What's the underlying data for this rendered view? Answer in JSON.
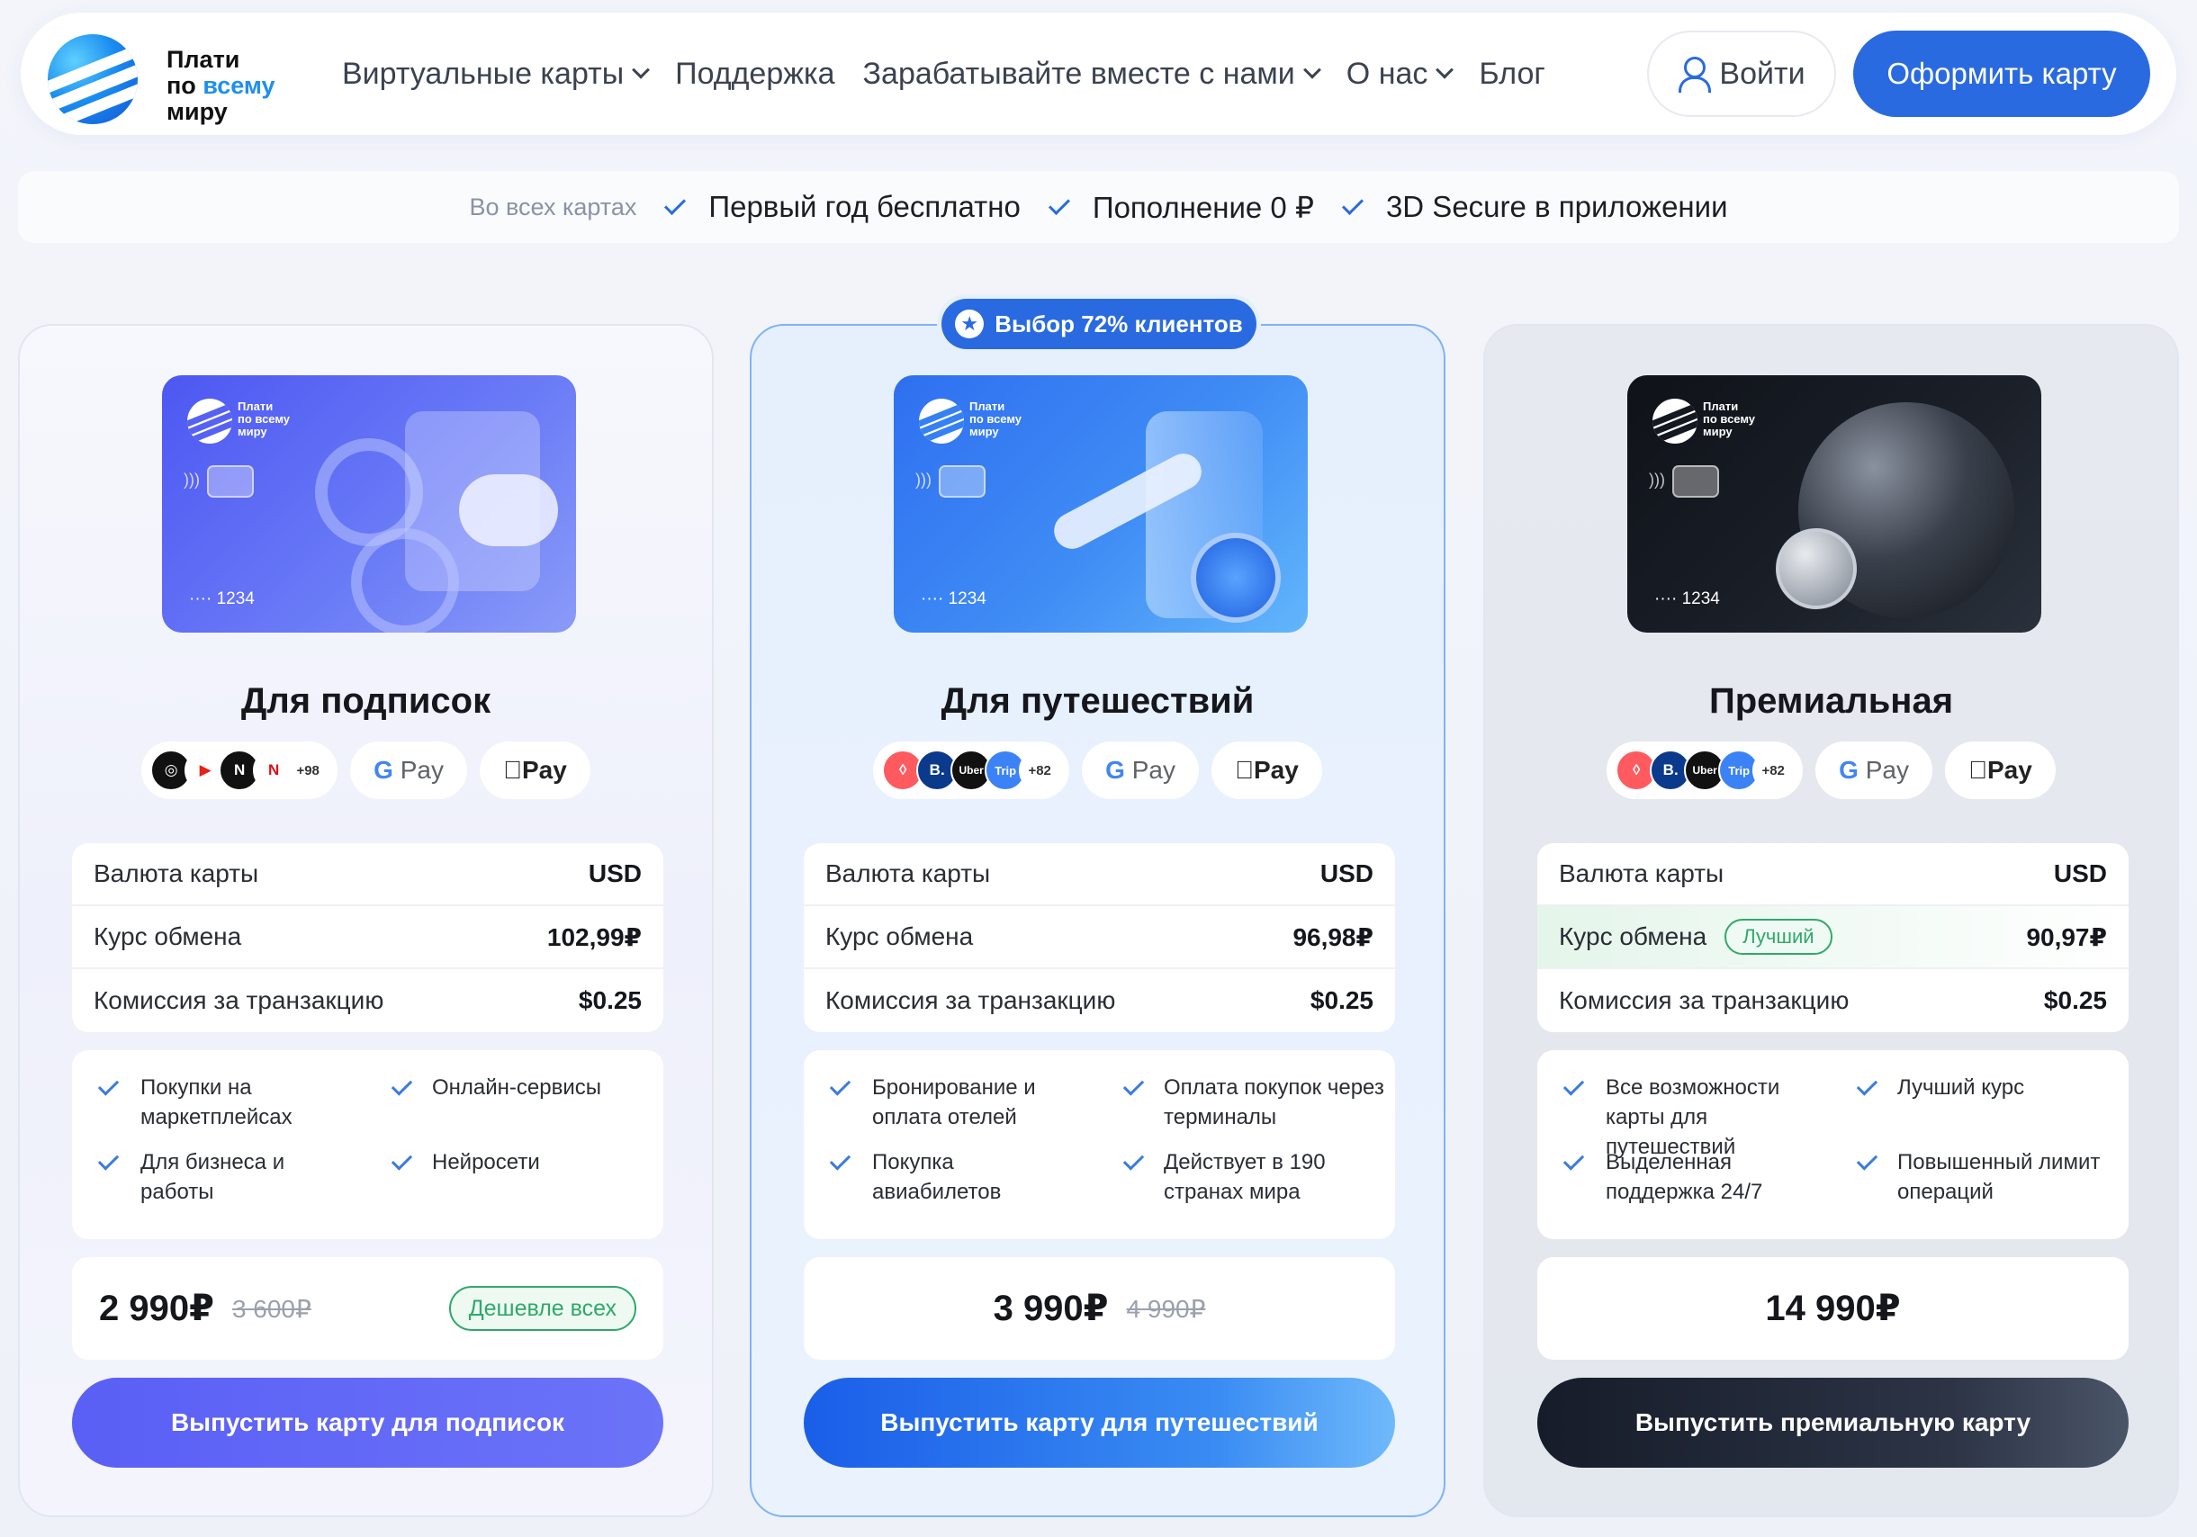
{
  "header": {
    "logo": {
      "line1": "Плати",
      "line2a": "по",
      "line2b": "всему",
      "line3": "миру"
    },
    "nav": [
      {
        "label": "Виртуальные карты",
        "dropdown": true
      },
      {
        "label": "Поддержка",
        "dropdown": false
      },
      {
        "label": "Зарабатывайте вместе с нами",
        "dropdown": true
      },
      {
        "label": "О нас",
        "dropdown": true
      },
      {
        "label": "Блог",
        "dropdown": false
      }
    ],
    "login_label": "Войти",
    "order_label": "Оформить карту"
  },
  "strip": {
    "label": "Во всех картах",
    "items": [
      "Первый год бесплатно",
      "Пополнение 0 ₽",
      "3D Secure в приложении"
    ]
  },
  "popular_badge": "Выбор 72% клиентов",
  "card_brand": {
    "line1": "Плати",
    "line2": "по всему",
    "line3": "миру"
  },
  "card_number": "···· 1234",
  "plans": [
    {
      "title": "Для подписок",
      "services_more": "+98",
      "gpay": {
        "g": "G",
        "pay": "Pay"
      },
      "apay": " Pay",
      "rows": [
        {
          "k": "Валюта карты",
          "v": "USD"
        },
        {
          "k": "Курс обмена",
          "v": "102,99₽"
        },
        {
          "k": "Комиссия за транзакцию",
          "v": "$0.25"
        }
      ],
      "features": [
        "Покупки на маркетплейсах",
        "Онлайн-сервисы",
        "Для бизнеса и работы",
        "Нейросети"
      ],
      "price_now": "2 990₽",
      "price_old": "3 600₽",
      "price_badge": "Дешевле всех",
      "cta": "Выпустить карту для подписок"
    },
    {
      "title": "Для путешествий",
      "services_more": "+82",
      "gpay": {
        "g": "G",
        "pay": "Pay"
      },
      "apay": " Pay",
      "rows": [
        {
          "k": "Валюта карты",
          "v": "USD"
        },
        {
          "k": "Курс обмена",
          "v": "96,98₽"
        },
        {
          "k": "Комиссия за транзакцию",
          "v": "$0.25"
        }
      ],
      "features": [
        "Бронирование и оплата отелей",
        "Оплата покупок через терминалы",
        "Покупка авиабилетов",
        "Действует в 190 странах мира"
      ],
      "price_now": "3 990₽",
      "price_old": "4 990₽",
      "cta": "Выпустить карту для путешествий"
    },
    {
      "title": "Премиальная",
      "services_more": "+82",
      "gpay": {
        "g": "G",
        "pay": "Pay"
      },
      "apay": " Pay",
      "rows": [
        {
          "k": "Валюта карты",
          "v": "USD"
        },
        {
          "k": "Курс обмена",
          "v": "90,97₽",
          "badge": "Лучший"
        },
        {
          "k": "Комиссия за транзакцию",
          "v": "$0.25"
        }
      ],
      "features": [
        "Все возможности карты для путешествий",
        "Лучший курс",
        "Выделенная поддержка 24/7",
        "Повышенный лимит операций"
      ],
      "price_now": "14 990₽",
      "cta": "Выпустить премиальную карту"
    }
  ],
  "colors": {
    "accent": "#2a6ae0",
    "success": "#2ea96a"
  }
}
